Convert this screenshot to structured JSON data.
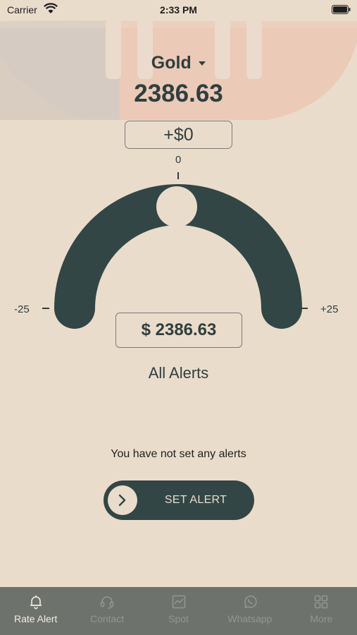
{
  "status_bar": {
    "carrier": "Carrier",
    "time": "2:33 PM"
  },
  "commodity": {
    "name": "Gold"
  },
  "price": {
    "current": "2386.63"
  },
  "gauge": {
    "offset_label": "+$0",
    "tick_center": "0",
    "tick_min": "-25",
    "tick_max": "+25",
    "target_price": "$ 2386.63",
    "position": 0
  },
  "alerts": {
    "title": "All Alerts",
    "empty_message": "You have not set any alerts",
    "set_alert_label": "SET ALERT"
  },
  "tabs": [
    {
      "label": "Rate Alert",
      "icon": "bell-icon",
      "active": true
    },
    {
      "label": "Contact",
      "icon": "headset-icon",
      "active": false
    },
    {
      "label": "Spot",
      "icon": "chart-icon",
      "active": false
    },
    {
      "label": "Whatsapp",
      "icon": "whatsapp-icon",
      "active": false
    },
    {
      "label": "More",
      "icon": "grid-icon",
      "active": false
    }
  ],
  "colors": {
    "background": "#eadccb",
    "accent": "#324645",
    "tab_bar": "#6e726d"
  }
}
